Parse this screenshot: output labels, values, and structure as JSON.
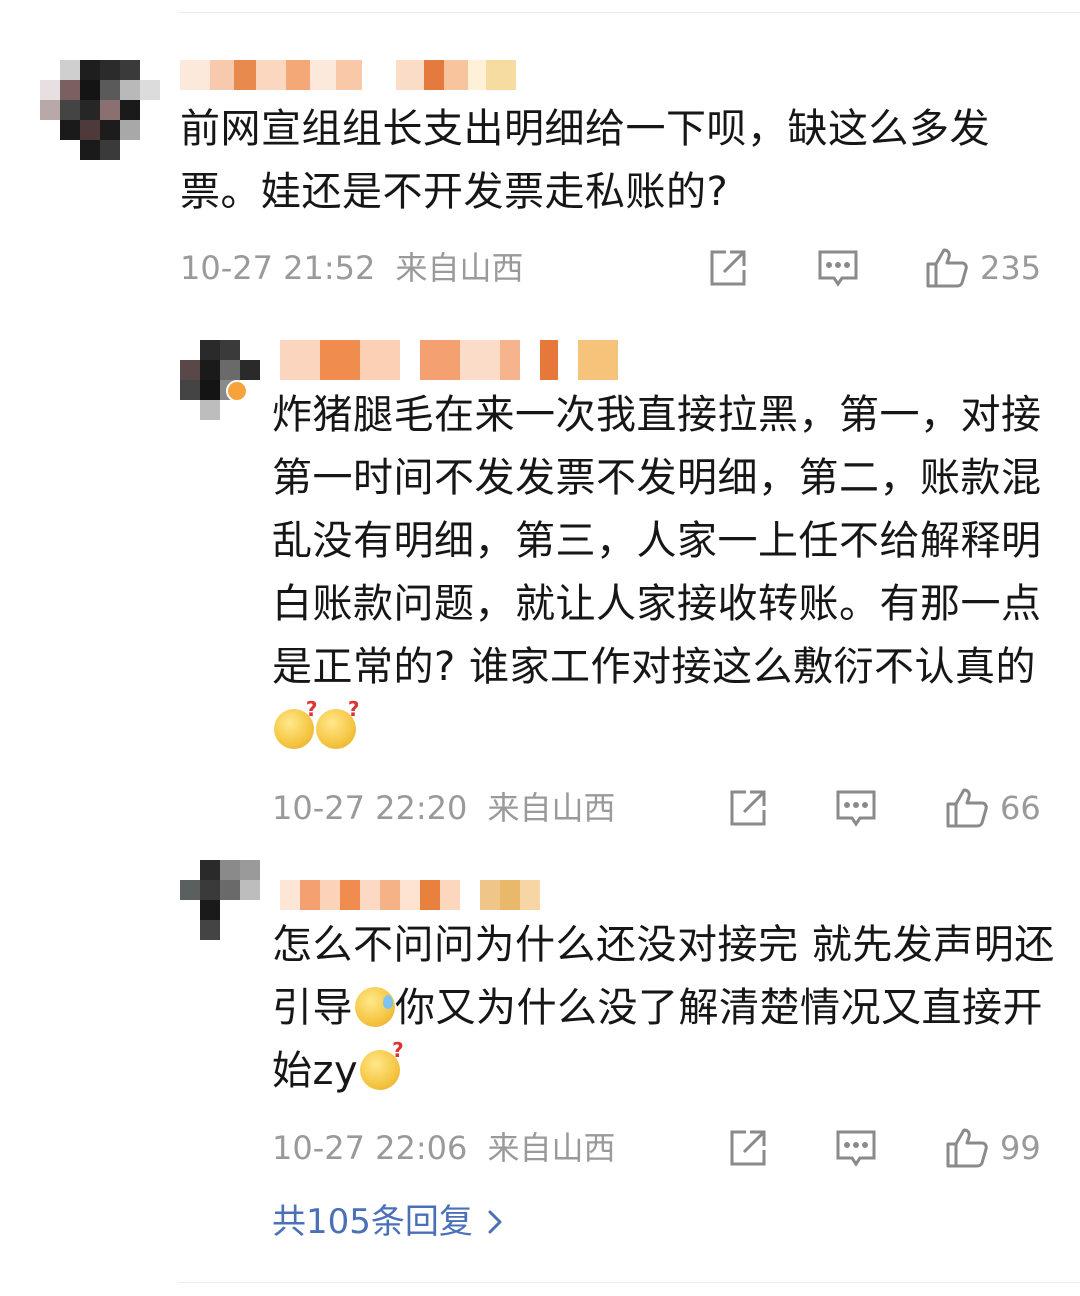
{
  "comments": [
    {
      "text": "前网宣组组长支出明细给一下呗，缺这么多发票。娃还是不开发票走私账的?",
      "time": "10-27 21:52",
      "location": "来自山西",
      "likes": "235"
    },
    {
      "text": "炸猪腿毛在来一次我直接拉黑，第一，对接第一时间不发发票不发明细，第二，账款混乱没有明细，第三，人家一上任不给解释明白账款问题，就让人家接收转账。有那一点是正常的? 谁家工作对接这么敷衍不认真的",
      "time": "10-27 22:20",
      "location": "来自山西",
      "likes": "66"
    },
    {
      "text_part1": "怎么不问问为什么还没对接完 就先发声明还引导",
      "text_part2": "你又为什么没了解清楚情况又直接开始zy",
      "time": "10-27 22:06",
      "location": "来自山西",
      "likes": "99"
    }
  ],
  "more_replies": "共105条回复",
  "icons": {
    "repost": "repost-icon",
    "comment": "comment-icon",
    "like": "thumbs-up-icon",
    "more": "chevron-right-icon"
  },
  "colors": {
    "link": "#4a70b8",
    "meta": "#9a9a9a",
    "text": "#161616"
  }
}
